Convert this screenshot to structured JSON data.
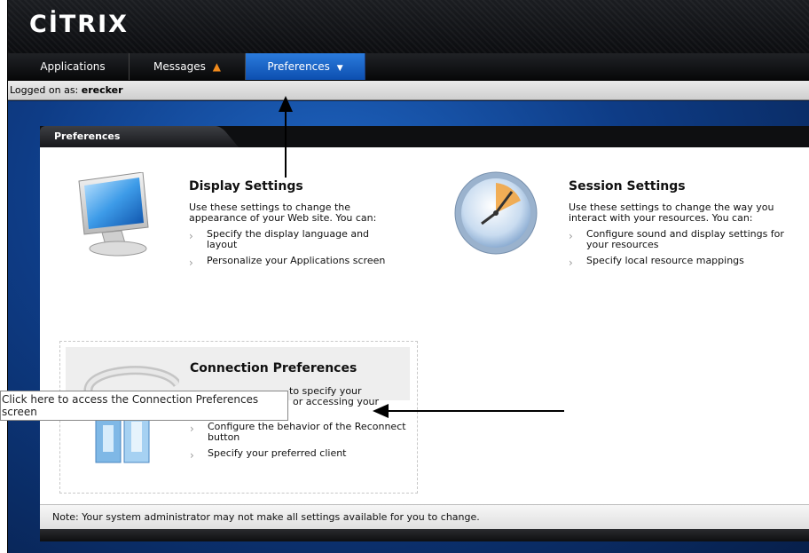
{
  "header": {
    "logo_text": "CİTRIX"
  },
  "tabs": [
    {
      "label": "Applications"
    },
    {
      "label": "Messages",
      "warning_icon": "warning-triangle-icon"
    },
    {
      "label": "Preferences",
      "active": true,
      "dropdown_icon": "caret-down-icon"
    }
  ],
  "logged": {
    "prefix": "Logged on as: ",
    "user": "erecker"
  },
  "panel": {
    "title": "Preferences"
  },
  "display": {
    "title": "Display Settings",
    "desc": "Use these settings to change the appearance of your Web site. You can:",
    "items": [
      "Specify the display language and layout",
      "Personalize your Applications screen"
    ],
    "icon": "monitor-icon"
  },
  "session": {
    "title": "Session Settings",
    "desc": "Use these settings to change the way you interact with your resources. You can:",
    "items": [
      "Configure sound and display settings for your resources",
      "Specify local resource mappings"
    ],
    "icon": "clock-icon"
  },
  "connection": {
    "title": "Connection Preferences",
    "desc_visible_1": "to specify your",
    "desc_visible_2": "or accessing your",
    "items": [
      "Configure the behavior of the Reconnect button",
      "Specify your preferred client"
    ],
    "icon": "connection-icon"
  },
  "tooltip": {
    "text": "Click here to access the Connection Preferences screen"
  },
  "footer": {
    "note": "Note: Your system administrator may not make all settings available for you to change."
  },
  "colors": {
    "active_tab": "#1f6fd0",
    "background": "#0e3c86",
    "arrow": "#000000"
  }
}
